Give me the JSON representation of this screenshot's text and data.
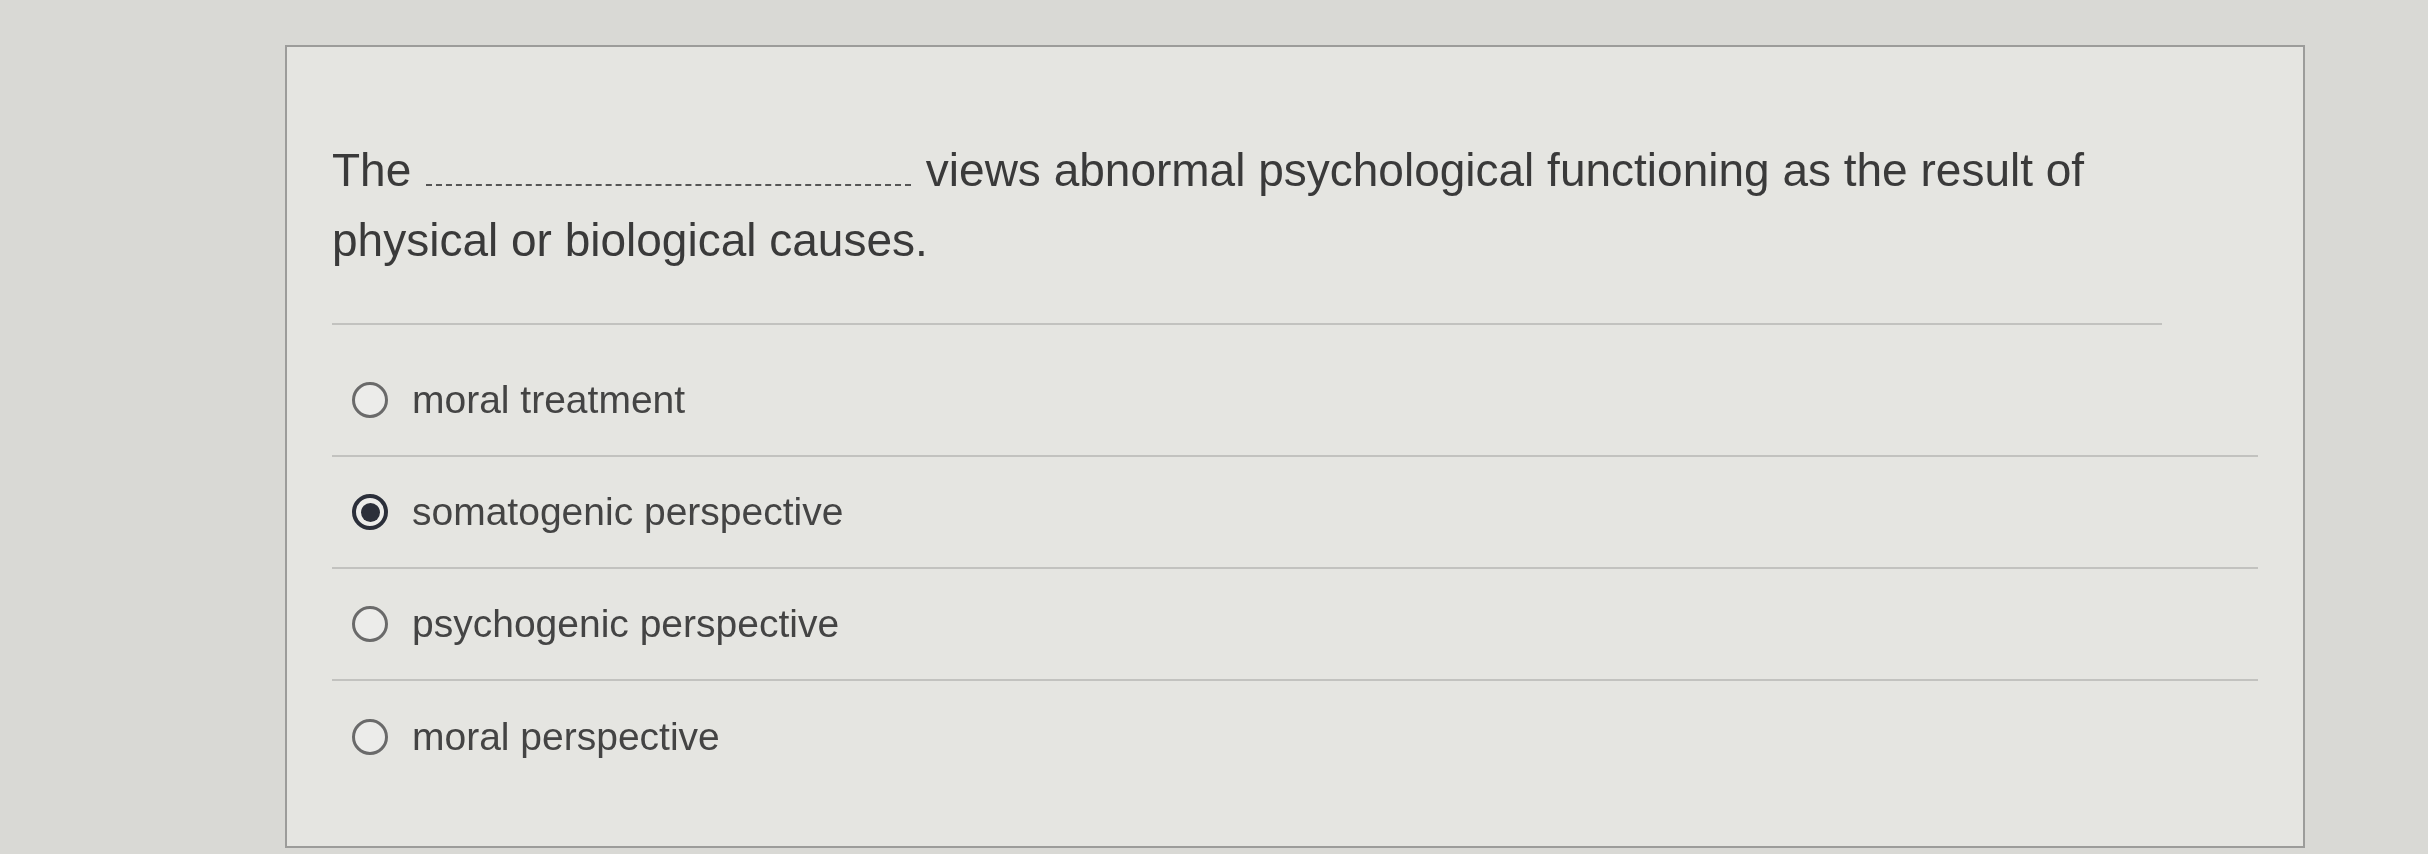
{
  "question": {
    "text_before_blank": "The",
    "text_after_blank": "views abnormal psychological functioning as the result of physical or biological causes."
  },
  "options": [
    {
      "label": "moral treatment",
      "selected": false
    },
    {
      "label": "somatogenic perspective",
      "selected": true
    },
    {
      "label": "psychogenic perspective",
      "selected": false
    },
    {
      "label": "moral perspective",
      "selected": false
    }
  ]
}
